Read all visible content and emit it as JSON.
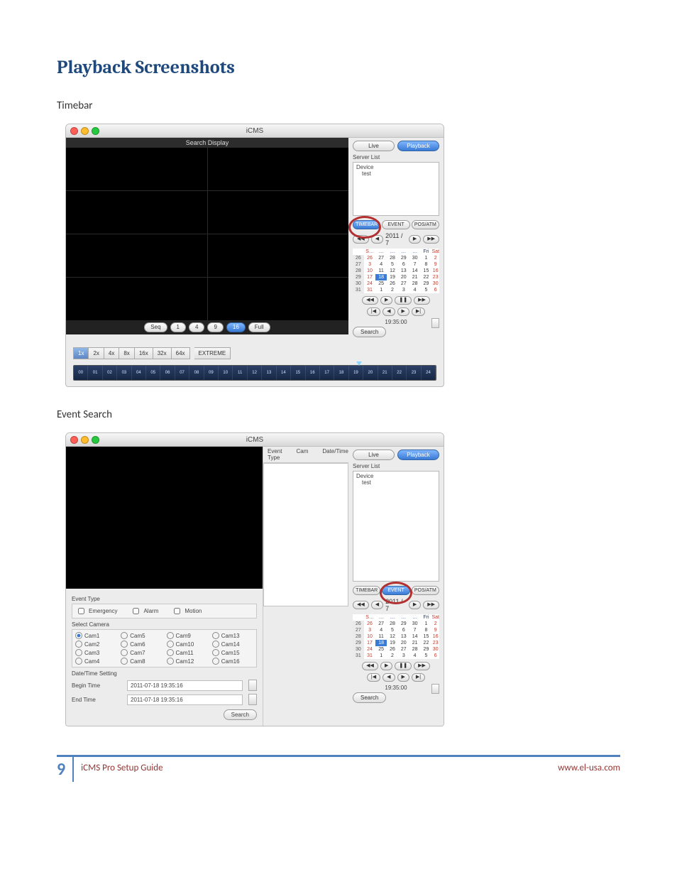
{
  "page": {
    "heading": "Playback Screenshots",
    "sub1": "Timebar",
    "sub2": "Event Search",
    "footer_guide": "iCMS Pro Setup Guide",
    "footer_url": "www.el-usa.com",
    "page_number": "9"
  },
  "cms": {
    "title": "iCMS",
    "search_display": "Search Display",
    "mode": {
      "live": "Live",
      "playback": "Playback"
    },
    "server_list": "Server List",
    "device": "Device",
    "device_name": "test",
    "tabs": {
      "timebar": "TIMEBAR",
      "event": "EVENT",
      "posatm": "POS/ATM"
    },
    "layout": {
      "seq": "Seq",
      "l1": "1",
      "l4": "4",
      "l9": "9",
      "l16": "16",
      "full": "Full"
    },
    "speed": {
      "s1": "1x",
      "s2": "2x",
      "s4": "4x",
      "s8": "8x",
      "s16": "16x",
      "s32": "32x",
      "s64": "64x",
      "extreme": "EXTREME"
    },
    "nav_year": "2011 / 7",
    "wk": {
      "h1": "S…",
      "h2": "…",
      "h3": "…",
      "h4": "…",
      "h5": "…",
      "h6": "Fri",
      "h7": "Sat"
    },
    "cal": {
      "r1": [
        "26",
        "26",
        "27",
        "28",
        "29",
        "30",
        "1",
        "2"
      ],
      "r2": [
        "27",
        "3",
        "4",
        "5",
        "6",
        "7",
        "8",
        "9"
      ],
      "r3": [
        "28",
        "10",
        "11",
        "12",
        "13",
        "14",
        "15",
        "16"
      ],
      "r4": [
        "29",
        "17",
        "18",
        "19",
        "20",
        "21",
        "22",
        "23"
      ],
      "r5": [
        "30",
        "24",
        "25",
        "26",
        "27",
        "28",
        "29",
        "30"
      ],
      "r6": [
        "31",
        "31",
        "1",
        "2",
        "3",
        "4",
        "5",
        "6"
      ]
    },
    "timecode": "19:35:00",
    "search": "Search",
    "timeline_hours": [
      "00",
      "01",
      "02",
      "03",
      "04",
      "05",
      "06",
      "07",
      "08",
      "09",
      "10",
      "11",
      "12",
      "13",
      "14",
      "15",
      "16",
      "17",
      "18",
      "19",
      "20",
      "21",
      "22",
      "23",
      "24"
    ]
  },
  "event": {
    "results_headers": {
      "type": "Event Type",
      "cam": "Cam",
      "dt": "Date/Time"
    },
    "event_type_label": "Event Type",
    "emergency": "Emergency",
    "alarm": "Alarm",
    "motion": "Motion",
    "select_camera": "Select Camera",
    "cams": [
      "Cam1",
      "Cam2",
      "Cam3",
      "Cam4",
      "Cam5",
      "Cam6",
      "Cam7",
      "Cam8",
      "Cam9",
      "Cam10",
      "Cam11",
      "Cam12",
      "Cam13",
      "Cam14",
      "Cam15",
      "Cam16"
    ],
    "dt_label": "Date/Time Setting",
    "begin_label": "Begin Time",
    "end_label": "End Time",
    "begin_value": "2011-07-18 19:35:16",
    "end_value": "2011-07-18 19:35:16",
    "search": "Search"
  }
}
